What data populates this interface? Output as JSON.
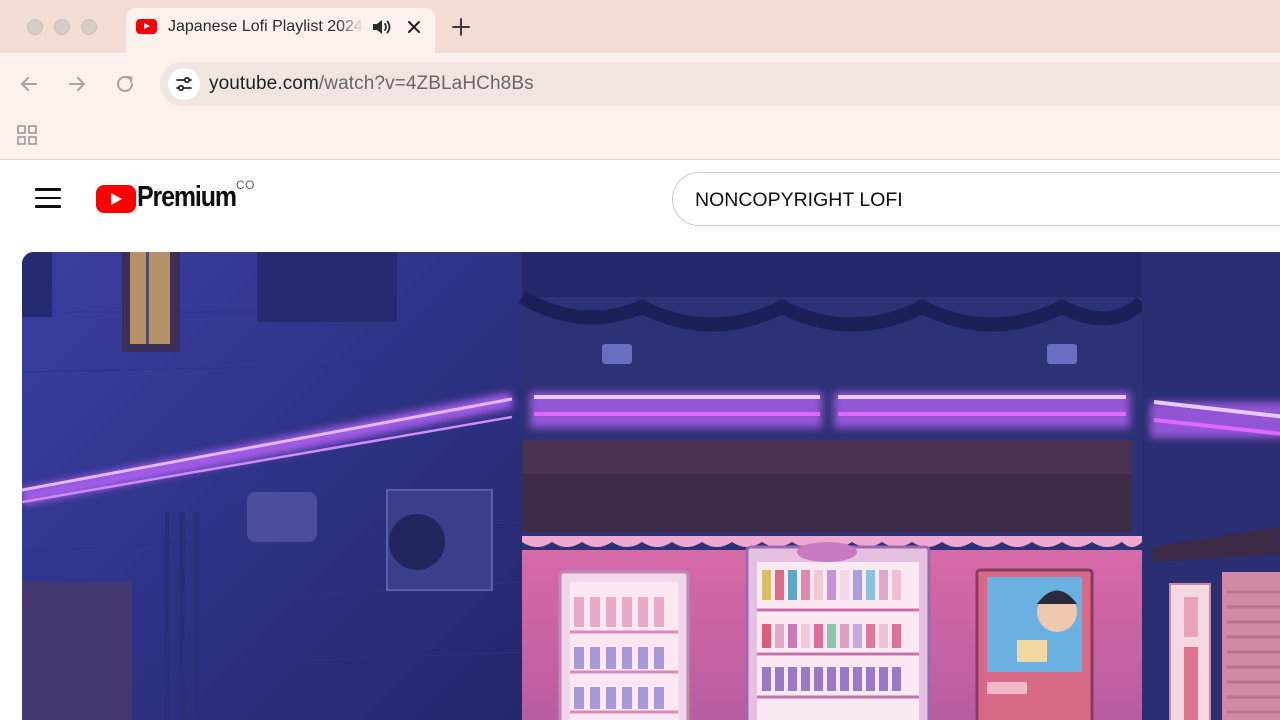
{
  "browser": {
    "tab": {
      "title": "Japanese Lofi Playlist 2024",
      "favicon": "youtube-favicon-icon",
      "audio_icon": "speaker-icon",
      "close_icon": "close-icon"
    },
    "new_tab_icon": "plus-icon",
    "nav": {
      "back_icon": "arrow-left-icon",
      "forward_icon": "arrow-right-icon",
      "reload_icon": "reload-icon"
    },
    "omnibox": {
      "site_info_icon": "tune-icon",
      "url_host": "youtube.com",
      "url_path": "/watch?v=4ZBLaHCh8Bs"
    },
    "bookmarks_bar": {
      "apps_icon": "apps-grid-icon"
    }
  },
  "youtube": {
    "menu_icon": "hamburger-menu-icon",
    "logo": {
      "icon": "youtube-play-icon",
      "wordmark": "Premium",
      "country_code": "CO"
    },
    "search": {
      "value": "NONCOPYRIGHT LOFI"
    },
    "player": {
      "thumbnail": "neon-lit japanese street corner with vending machines at night"
    }
  },
  "colors": {
    "tabstrip_bg": "#f3dcd3",
    "toolbar_bg": "#fcf1ed",
    "youtube_red": "#ff0000",
    "neon_purple": "#c066ff"
  }
}
